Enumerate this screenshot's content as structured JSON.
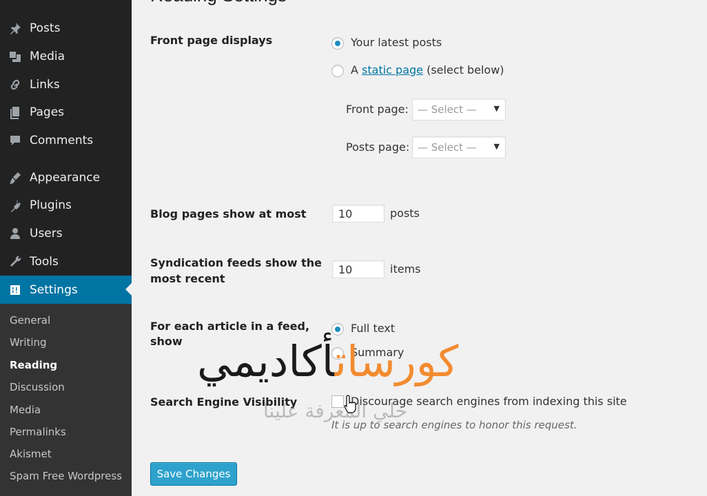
{
  "sidebar": {
    "items": [
      {
        "label": "Posts",
        "icon": "pin-icon"
      },
      {
        "label": "Media",
        "icon": "media-icon"
      },
      {
        "label": "Links",
        "icon": "link-icon"
      },
      {
        "label": "Pages",
        "icon": "pages-icon"
      },
      {
        "label": "Comments",
        "icon": "comment-icon"
      },
      {
        "label": "Appearance",
        "icon": "brush-icon"
      },
      {
        "label": "Plugins",
        "icon": "plug-icon"
      },
      {
        "label": "Users",
        "icon": "user-icon"
      },
      {
        "label": "Tools",
        "icon": "wrench-icon"
      },
      {
        "label": "Settings",
        "icon": "settings-icon"
      }
    ],
    "submenu": [
      "General",
      "Writing",
      "Reading",
      "Discussion",
      "Media",
      "Permalinks",
      "Akismet",
      "Spam Free Wordpress"
    ],
    "active_color": "#0074a2"
  },
  "page": {
    "title": "Reading Settings"
  },
  "front_page": {
    "label": "Front page displays",
    "opt_latest": "Your latest posts",
    "opt_static_prefix": "A ",
    "opt_static_link": "static page",
    "opt_static_suffix": " (select below)",
    "front_label": "Front page:",
    "posts_label": "Posts page:",
    "select_value": "— Select —"
  },
  "blog_pages": {
    "label": "Blog pages show at most",
    "value": "10",
    "unit": "posts"
  },
  "syndication": {
    "label_line1": "Syndication feeds show the",
    "label_line2": "most recent",
    "value": "10",
    "unit": "items"
  },
  "feed_article": {
    "label_line1": "For each article in a feed,",
    "label_line2": "show",
    "opt_full": "Full text",
    "opt_summary": "Summary"
  },
  "search_engine": {
    "label": "Search Engine Visibility",
    "checkbox_label": "Discourage search engines from indexing this site",
    "description": "It is up to search engines to honor this request."
  },
  "actions": {
    "save_label": "Save Changes"
  },
  "watermark": {
    "part_a": "أكاديمي",
    "part_b": "كورسات",
    "tagline": "خلي المعرفة علينا"
  }
}
